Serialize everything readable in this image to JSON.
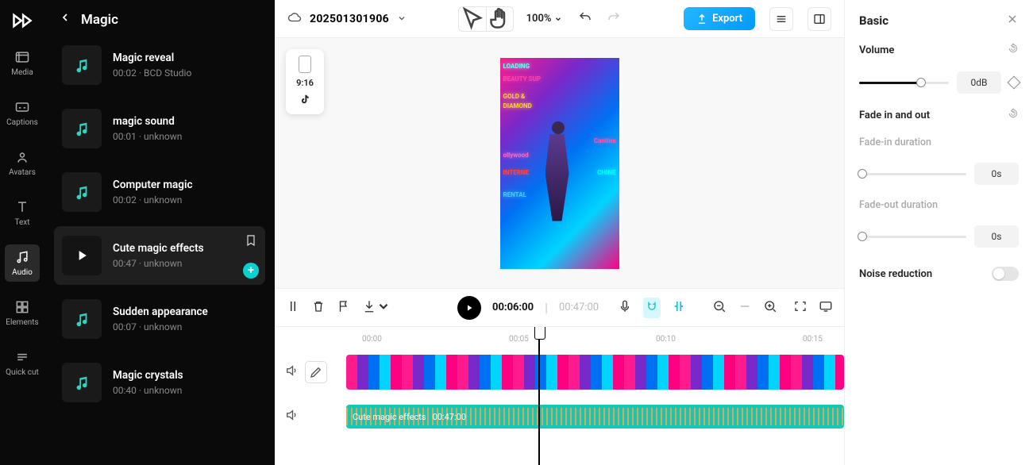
{
  "rail": {
    "items": [
      {
        "label": "Media"
      },
      {
        "label": "Captions"
      },
      {
        "label": "Avatars"
      },
      {
        "label": "Text"
      },
      {
        "label": "Audio"
      },
      {
        "label": "Elements"
      },
      {
        "label": "Quick cut"
      }
    ],
    "active": 4
  },
  "sidebar": {
    "title": "Magic",
    "tracks": [
      {
        "title": "Magic reveal",
        "meta": "00:02 · BCD Studio"
      },
      {
        "title": "magic sound",
        "meta": "00:01 · unknown"
      },
      {
        "title": "Computer magic",
        "meta": "00:02 · unknown"
      },
      {
        "title": "Cute magic effects",
        "meta": "00:47 · unknown",
        "selected": true
      },
      {
        "title": "Sudden appearance",
        "meta": "00:07 · unknown"
      },
      {
        "title": "Magic crystals",
        "meta": "00:40 · unknown"
      }
    ]
  },
  "topbar": {
    "project": "202501301906",
    "zoom": "100%",
    "export": "Export"
  },
  "preview": {
    "ratio": "9:16",
    "neon": [
      "LOADING",
      "BEAUTY SUP",
      "GOLD &",
      "DIAMOND",
      "Cantina",
      "ollywood",
      "INTERNE",
      "CHINE",
      "RENTAL"
    ]
  },
  "timeline_toolbar": {
    "current": "00:06:00",
    "duration": "00:47:00"
  },
  "timeline": {
    "ticks": [
      "00:00",
      "00:05",
      "00:10",
      "00:15"
    ],
    "audio_clip_name": "Cute magic effects",
    "audio_clip_dur": "00:47:00"
  },
  "right_panel": {
    "title": "Basic",
    "volume_label": "Volume",
    "volume_value": "0dB",
    "fade_label": "Fade in and out",
    "fade_in_label": "Fade-in duration",
    "fade_in_value": "0s",
    "fade_out_label": "Fade-out duration",
    "fade_out_value": "0s",
    "noise_label": "Noise reduction"
  }
}
